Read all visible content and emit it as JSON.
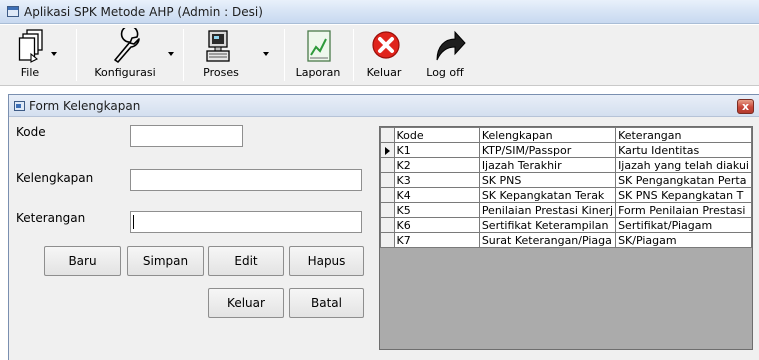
{
  "window": {
    "title": "Aplikasi SPK Metode AHP  (Admin : Desi)"
  },
  "toolbar": {
    "file": "File",
    "konfigurasi": "Konfigurasi",
    "proses": "Proses",
    "laporan": "Laporan",
    "keluar": "Keluar",
    "logoff": "Log off"
  },
  "form": {
    "title": "Form Kelengkapan",
    "close_glyph": "x",
    "labels": {
      "kode": "Kode",
      "kelengkapan": "Kelengkapan",
      "keterangan": "Keterangan"
    },
    "values": {
      "kode": "",
      "kelengkapan": "",
      "keterangan": ""
    },
    "buttons": {
      "baru": "Baru",
      "simpan": "Simpan",
      "edit": "Edit",
      "hapus": "Hapus",
      "keluar": "Keluar",
      "batal": "Batal"
    }
  },
  "grid": {
    "columns": [
      "Kode",
      "Kelengkapan",
      "Keterangan"
    ],
    "current_row_index": 0,
    "rows": [
      [
        "K1",
        "KTP/SIM/Passpor",
        "Kartu Identitas"
      ],
      [
        "K2",
        "Ijazah Terakhir",
        "Ijazah yang telah diakui"
      ],
      [
        "K3",
        "SK PNS",
        "SK Pengangkatan Perta"
      ],
      [
        "K4",
        "SK Kepangkatan Terak",
        "SK PNS Kepangkatan T"
      ],
      [
        "K5",
        "Penilaian Prestasi Kinerj",
        "Form Penilaian Prestasi"
      ],
      [
        "K6",
        "Sertifikat Keterampilan",
        "Sertifikat/Piagam"
      ],
      [
        "K7",
        "Surat Keterangan/Piaga",
        "SK/Piagam"
      ]
    ]
  },
  "icons": {
    "file": "document-stack-icon",
    "konfigurasi": "wrench-icon",
    "proses": "computer-icon",
    "laporan": "chart-report-icon",
    "keluar": "exit-x-icon",
    "logoff": "logoff-arrow-icon"
  },
  "colors": {
    "exit_red": "#e0241c",
    "title_bar": "#d7e4f5",
    "form_bg": "#f0f0f0"
  }
}
